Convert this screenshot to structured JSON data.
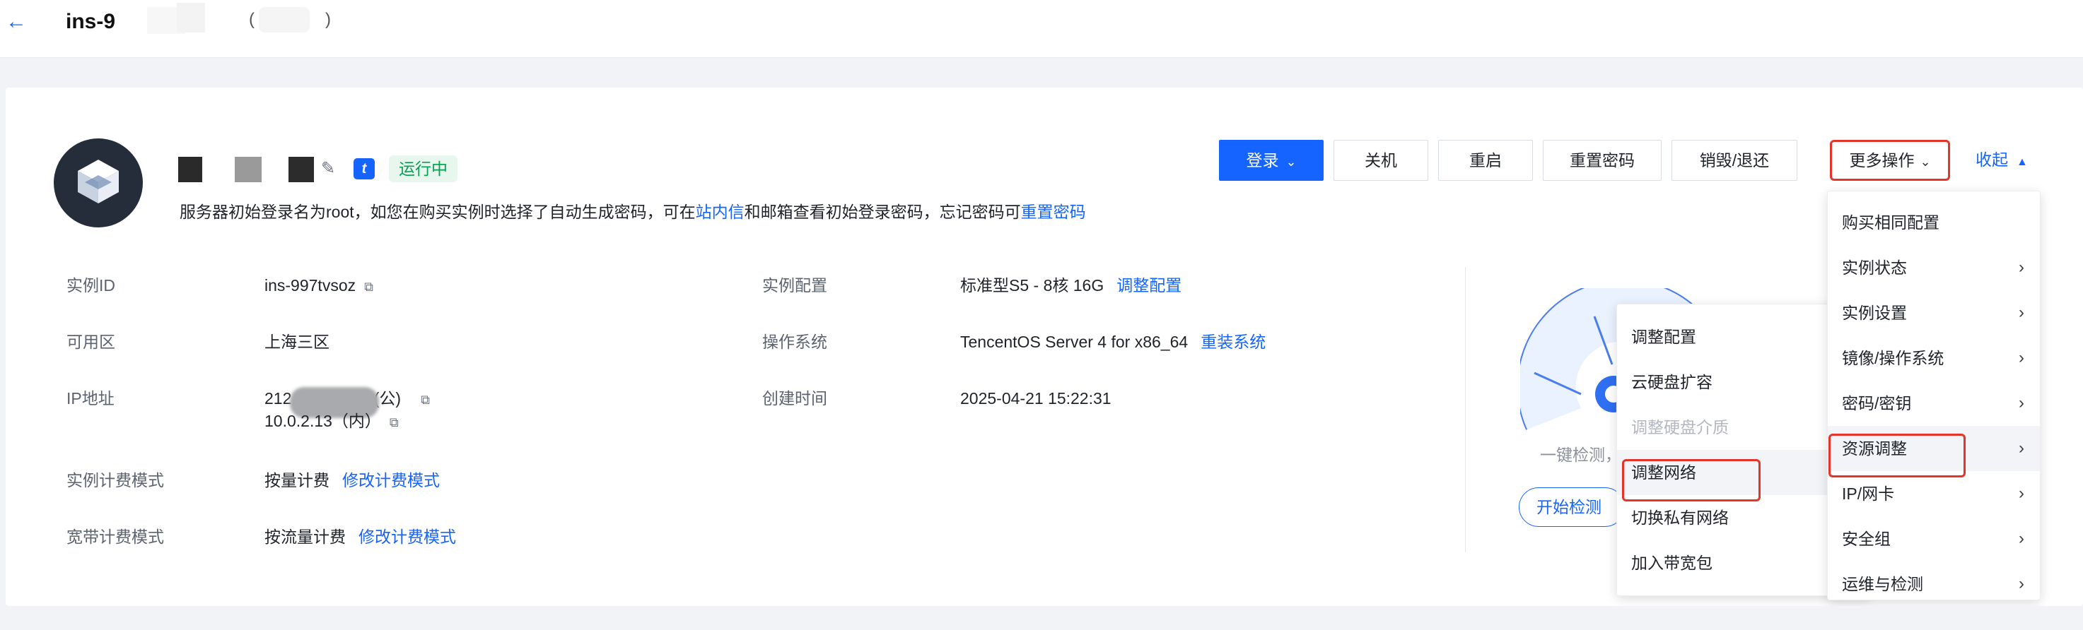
{
  "header": {
    "back_icon": "arrow-left-icon",
    "title": "ins-9",
    "paren_open": "(",
    "paren_close": ")"
  },
  "instance": {
    "status": "运行中",
    "brand_badge": "t",
    "login_hint_prefix": "服务器初始登录名为root，如您在购买实例时选择了自动生成密码，可在",
    "login_hint_link_inbox": "站内信",
    "login_hint_middle": "和邮箱查看初始登录密码，忘记密码可",
    "login_hint_link_reset": "重置密码"
  },
  "actions": {
    "login": "登录",
    "shutdown": "关机",
    "restart": "重启",
    "reset_password": "重置密码",
    "destroy": "销毁/退还",
    "more": "更多操作",
    "collapse": "收起"
  },
  "info": {
    "instance_id_label": "实例ID",
    "instance_id_value": "ins-997tvsoz",
    "zone_label": "可用区",
    "zone_value": "上海三区",
    "ip_label": "IP地址",
    "ip_public_value": "212.",
    "ip_public_suffix": "(公)",
    "ip_private_value": "10.0.2.13（内）",
    "billing_label": "实例计费模式",
    "billing_value": "按量计费",
    "billing_link": "修改计费模式",
    "bandwidth_label": "宽带计费模式",
    "bandwidth_value": "按流量计费",
    "bandwidth_link": "修改计费模式",
    "config_label": "实例配置",
    "config_value": "标准型S5 - 8核 16G",
    "config_link": "调整配置",
    "os_label": "操作系统",
    "os_value": "TencentOS Server 4 for x86_64",
    "os_link": "重装系统",
    "created_label": "创建时间",
    "created_value": "2025-04-21 15:22:31"
  },
  "health": {
    "check_text": "一键检测，",
    "start_button": "开始检测"
  },
  "more_menu": {
    "items": [
      {
        "label": "购买相同配置",
        "submenu": false
      },
      {
        "label": "实例状态",
        "submenu": true
      },
      {
        "label": "实例设置",
        "submenu": true
      },
      {
        "label": "镜像/操作系统",
        "submenu": true
      },
      {
        "label": "密码/密钥",
        "submenu": true
      },
      {
        "label": "资源调整",
        "submenu": true
      },
      {
        "label": "IP/网卡",
        "submenu": true
      },
      {
        "label": "安全组",
        "submenu": true
      },
      {
        "label": "运维与检测",
        "submenu": true
      }
    ]
  },
  "sub_menu": {
    "items": [
      {
        "label": "调整配置",
        "disabled": false
      },
      {
        "label": "云硬盘扩容",
        "disabled": false
      },
      {
        "label": "调整硬盘介质",
        "disabled": true
      },
      {
        "label": "调整网络",
        "disabled": false
      },
      {
        "label": "切换私有网络",
        "disabled": false
      },
      {
        "label": "加入带宽包",
        "disabled": false
      }
    ]
  },
  "colors": {
    "primary": "#1664ff",
    "status_green": "#0a9e52",
    "highlight_red": "#e5352b"
  }
}
